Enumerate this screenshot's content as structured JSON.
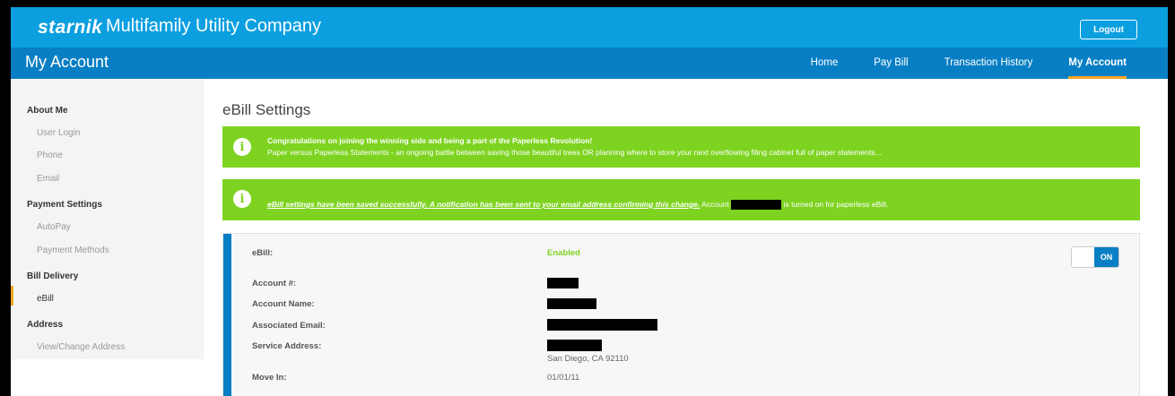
{
  "header": {
    "logo_text": "starnik",
    "company": "Multifamily Utility Company",
    "logout_label": "Logout"
  },
  "navbar": {
    "page_heading": "My Account",
    "items": [
      {
        "label": "Home"
      },
      {
        "label": "Pay Bill"
      },
      {
        "label": "Transaction History"
      },
      {
        "label": "My Account",
        "active": true
      }
    ]
  },
  "sidebar": {
    "sections": [
      {
        "heading": "About Me",
        "items": [
          "User Login",
          "Phone",
          "Email"
        ]
      },
      {
        "heading": "Payment Settings",
        "items": [
          "AutoPay",
          "Payment Methods"
        ]
      },
      {
        "heading": "Bill Delivery",
        "items": [
          "eBill"
        ]
      },
      {
        "heading": "Address",
        "items": [
          "View/Change Address"
        ]
      }
    ],
    "active_item": "eBill"
  },
  "main": {
    "title": "eBill Settings",
    "alert1": {
      "icon": "info-icon",
      "line1": "Congratulations on joining the winning side and being a part of the Paperless Revolution!",
      "line2": "Paper versus Paperless Statements - an ongoing battle between saving those beautiful trees OR planning where to store your next overflowing filing cabinet full of paper statements..."
    },
    "alert2": {
      "icon": "info-icon",
      "link_text": "eBill settings have been saved successfully. A notification has been sent to your email address confirming this change.",
      "text_before": " Account ",
      "text_after": " is turned on for paperless eBill."
    },
    "card": {
      "ebill_label": "eBill:",
      "ebill_value": "Enabled",
      "toggle_label": "ON",
      "account_number_label": "Account #:",
      "account_name_label": "Account Name:",
      "email_label": "Associated Email:",
      "service_address_label": "Service Address:",
      "service_address_city": "San Diego, CA 92110",
      "move_in_label": "Move In:",
      "move_in_value": "01/01/11"
    }
  },
  "colors": {
    "top_bar": "#0b9fe0",
    "nav_bar": "#087fc4",
    "alert_green": "#7ed321",
    "active_underline": "#f5a623"
  }
}
